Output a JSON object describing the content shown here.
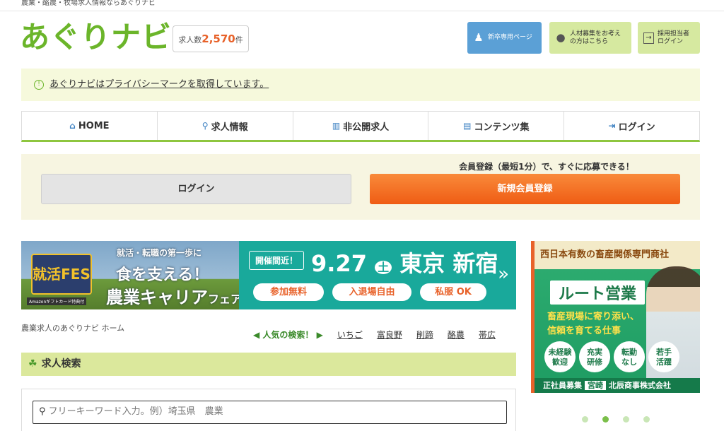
{
  "top_tagline": "農業・酪農・牧場求人情報ならあぐりナビ",
  "logo": "あぐりナビ",
  "job_count": {
    "prefix": "求人数",
    "value": "2,570",
    "suffix": "件"
  },
  "header_buttons": [
    {
      "label": "新卒専用ページ",
      "icon": "graduate-icon"
    },
    {
      "label_line1": "人材募集をお考え",
      "label_line2": "の方はこちら",
      "icon": "person-icon"
    },
    {
      "label_line1": "採用担当者",
      "label_line2": "ログイン",
      "icon": "login-icon"
    }
  ],
  "notice": "あぐりナビはプライバシーマークを取得しています。",
  "nav": [
    {
      "label": "HOME",
      "icon": "home-icon"
    },
    {
      "label": "求人情報",
      "icon": "search-icon"
    },
    {
      "label": "非公開求人",
      "icon": "building-icon"
    },
    {
      "label": "コンテンツ集",
      "icon": "book-icon"
    },
    {
      "label": "ログイン",
      "icon": "login-icon"
    }
  ],
  "register": {
    "caption": "会員登録（最短1分）で、すぐに応募できる！",
    "login_label": "ログイン",
    "signup_label": "新規会員登録"
  },
  "banner": {
    "fes_logo": "就活FES",
    "amazon_note": "Amazonギフトカード特典付",
    "sub": "就活・転職の第一歩に",
    "main": "食を支える！",
    "big": "農業キャリア",
    "big_small": "フェア",
    "kaisai": "開催間近！",
    "date": "9.27",
    "weekday": "土",
    "place": "東京 新宿",
    "pills": [
      "参加無料",
      "入退場自由",
      "私服 OK"
    ],
    "arrow": "»"
  },
  "breadcrumb": "農業求人のあぐりナビ ホーム",
  "popular": {
    "heading": "人気の検索！",
    "links": [
      "いちご",
      "富良野",
      "削蹄",
      "酪農",
      "帯広"
    ]
  },
  "search_section": {
    "title": "求人検索",
    "placeholder": "フリーキーワード入力。例）埼玉県　農業"
  },
  "ad": {
    "top": "西日本有数の畜産関係専門商社",
    "role": "ルート営業",
    "copy_line1": "畜産現場に寄り添い、",
    "copy_line2": "信頼を育てる仕事",
    "badges": [
      {
        "l1": "未経験",
        "l2": "歓迎"
      },
      {
        "l1": "充実",
        "l2": "研修"
      },
      {
        "l1": "転勤",
        "l2": "なし"
      },
      {
        "l1": "若手",
        "l2": "活躍"
      }
    ],
    "footer_a": "正社員募集",
    "footer_b": "宮崎",
    "footer_c": "北辰商事株式会社"
  },
  "carousel": {
    "count": 4,
    "active": 2
  }
}
